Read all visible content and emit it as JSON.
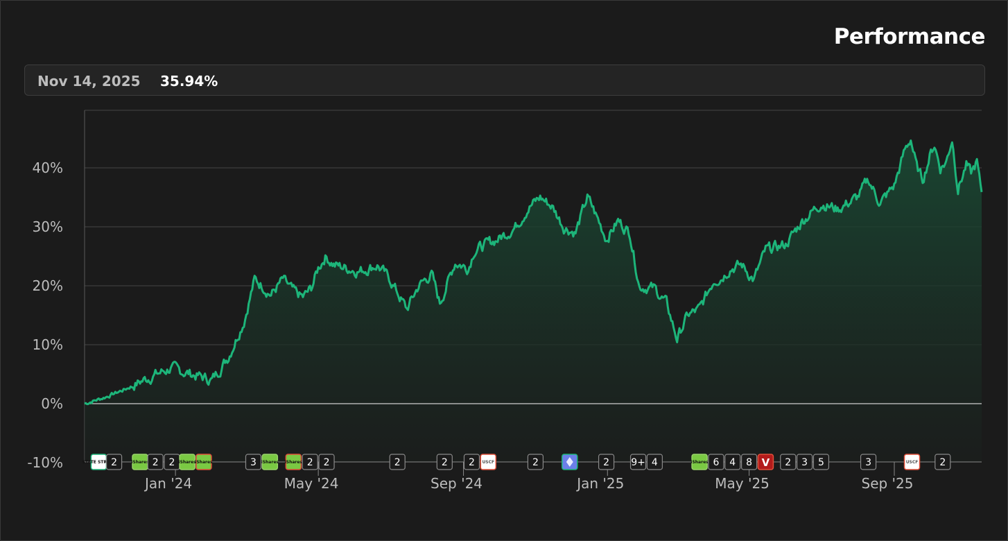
{
  "header": {
    "title": "Performance"
  },
  "readout": {
    "date": "Nov 14, 2025",
    "value": "35.94%"
  },
  "colors": {
    "line": "#1db57a",
    "area_top": "#1a4a34",
    "area_bottom": "#1b1f1d",
    "grid": "#444444",
    "zero_line": "#cfcfcf",
    "badge_border": "#8a8a8a",
    "badge_green": "#7ac943",
    "badge_red_border": "#e0503a",
    "badge_eth": "#6b7fe8",
    "badge_v": "#b31b1b"
  },
  "chart_data": {
    "type": "area",
    "title": "Performance",
    "ylabel": "",
    "xlabel": "",
    "ylim": [
      -10,
      50
    ],
    "y_ticks": [
      -10,
      0,
      10,
      20,
      30,
      40
    ],
    "y_tick_labels": [
      "-10%",
      "0%",
      "10%",
      "20%",
      "30%",
      "40%"
    ],
    "grid": true,
    "x_range": [
      "2023-10-16",
      "2025-11-14"
    ],
    "x_ticks": [
      "2024-01-01",
      "2024-05-01",
      "2024-09-01",
      "2025-01-01",
      "2025-05-01",
      "2025-09-01"
    ],
    "x_tick_labels": [
      "Jan '24",
      "May '24",
      "Sep '24",
      "Jan '25",
      "May '25",
      "Sep '25"
    ],
    "series": [
      {
        "x": [
          "2023-10-16",
          "2023-11-01",
          "2023-11-20",
          "2023-12-10",
          "2023-12-28",
          "2024-01-15",
          "2024-02-01",
          "2024-02-15",
          "2024-02-28",
          "2024-03-08",
          "2024-03-15",
          "2024-03-22",
          "2024-04-01",
          "2024-04-10",
          "2024-04-18",
          "2024-04-25",
          "2024-05-01",
          "2024-05-07",
          "2024-05-15",
          "2024-05-25",
          "2024-06-05",
          "2024-06-20",
          "2024-07-01",
          "2024-07-15",
          "2024-07-25",
          "2024-08-05",
          "2024-08-12",
          "2024-08-25",
          "2024-09-05",
          "2024-09-10",
          "2024-09-20",
          "2024-10-01",
          "2024-10-15",
          "2024-10-25",
          "2024-11-05",
          "2024-11-15",
          "2024-11-25",
          "2024-12-05",
          "2024-12-15",
          "2024-12-20",
          "2024-12-31",
          "2025-01-10",
          "2025-01-20",
          "2025-01-28",
          "2025-02-10",
          "2025-02-20",
          "2025-03-01",
          "2025-03-10",
          "2025-03-20",
          "2025-04-01",
          "2025-04-08",
          "2025-04-15",
          "2025-04-25",
          "2025-05-05",
          "2025-05-15",
          "2025-06-01",
          "2025-06-15",
          "2025-07-01",
          "2025-07-15",
          "2025-08-01",
          "2025-08-10",
          "2025-08-20",
          "2025-09-01",
          "2025-09-10",
          "2025-09-15",
          "2025-09-20",
          "2025-09-25",
          "2025-10-01",
          "2025-10-05",
          "2025-10-10",
          "2025-10-15",
          "2025-10-20",
          "2025-10-25",
          "2025-11-01",
          "2025-11-05",
          "2025-11-10",
          "2025-11-12",
          "2025-11-14"
        ],
        "values": [
          0,
          1,
          2.5,
          4.5,
          6,
          5,
          4,
          8,
          14,
          21,
          20,
          18.5,
          21,
          19,
          18,
          19.5,
          23,
          25,
          23.5,
          23,
          22.5,
          23.5,
          21,
          16,
          20,
          22,
          17,
          24,
          23,
          26,
          27,
          28,
          30,
          33,
          35,
          33.5,
          30,
          29,
          35,
          33,
          28,
          31,
          29,
          20,
          19.5,
          17,
          11,
          15,
          16,
          21,
          21.5,
          23,
          23.5,
          21,
          26,
          27,
          31,
          34,
          33,
          35,
          38,
          34,
          37,
          43,
          45,
          40,
          38,
          42,
          44,
          40,
          41,
          45,
          36.5,
          40.5,
          39,
          41,
          38,
          35.9
        ]
      }
    ]
  },
  "event_markers": [
    {
      "type": "logo",
      "icon": "state-street-logo",
      "text": "STATE STREET",
      "style": "white",
      "x": "2023-10-28"
    },
    {
      "type": "count",
      "label": "2",
      "x": "2023-11-10"
    },
    {
      "type": "logo",
      "icon": "ishares-logo",
      "text": "iShares",
      "style": "green",
      "x": "2023-12-02"
    },
    {
      "type": "count",
      "label": "2",
      "x": "2023-12-15"
    },
    {
      "type": "count",
      "label": "2",
      "x": "2023-12-29"
    },
    {
      "type": "logo",
      "icon": "ishares-logo",
      "text": "iShares",
      "style": "green",
      "x": "2024-01-11"
    },
    {
      "type": "logo",
      "icon": "ishares-logo",
      "text": "iShares",
      "style": "green-red",
      "x": "2024-01-25"
    },
    {
      "type": "count",
      "label": "3",
      "x": "2024-03-07"
    },
    {
      "type": "logo",
      "icon": "ishares-logo",
      "text": "iShares",
      "style": "green",
      "x": "2024-03-21"
    },
    {
      "type": "logo",
      "icon": "ishares-logo",
      "text": "iShares",
      "style": "green-red",
      "x": "2024-04-10"
    },
    {
      "type": "count",
      "label": "2",
      "x": "2024-04-24"
    },
    {
      "type": "count",
      "label": "2",
      "x": "2024-05-08"
    },
    {
      "type": "count",
      "label": "2",
      "x": "2024-07-07"
    },
    {
      "type": "count",
      "label": "2",
      "x": "2024-08-16"
    },
    {
      "type": "count",
      "label": "2",
      "x": "2024-09-08"
    },
    {
      "type": "logo",
      "icon": "uscf-logo",
      "text": "USCF",
      "style": "white-red",
      "x": "2024-09-22"
    },
    {
      "type": "count",
      "label": "2",
      "x": "2024-11-01"
    },
    {
      "type": "logo",
      "icon": "ethereum-logo",
      "text": "",
      "style": "eth",
      "x": "2024-11-30"
    },
    {
      "type": "count",
      "label": "2",
      "x": "2024-12-31"
    },
    {
      "type": "count",
      "label": "9+",
      "x": "2025-01-27"
    },
    {
      "type": "count",
      "label": "4",
      "x": "2025-02-10"
    },
    {
      "type": "logo",
      "icon": "ishares-logo",
      "text": "iShares",
      "style": "green",
      "x": "2025-03-20"
    },
    {
      "type": "count",
      "label": "6",
      "x": "2025-04-03"
    },
    {
      "type": "count",
      "label": "4",
      "x": "2025-04-17"
    },
    {
      "type": "count",
      "label": "8",
      "x": "2025-05-01"
    },
    {
      "type": "logo",
      "icon": "vanguard-logo",
      "text": "V",
      "style": "v",
      "x": "2025-05-15"
    },
    {
      "type": "count",
      "label": "2",
      "x": "2025-06-03"
    },
    {
      "type": "count",
      "label": "3",
      "x": "2025-06-17"
    },
    {
      "type": "count",
      "label": "5",
      "x": "2025-07-01"
    },
    {
      "type": "count",
      "label": "3",
      "x": "2025-08-10"
    },
    {
      "type": "logo",
      "icon": "uscf-logo",
      "text": "USCF",
      "style": "white-red",
      "x": "2025-09-16"
    },
    {
      "type": "count",
      "label": "2",
      "x": "2025-10-12"
    }
  ]
}
